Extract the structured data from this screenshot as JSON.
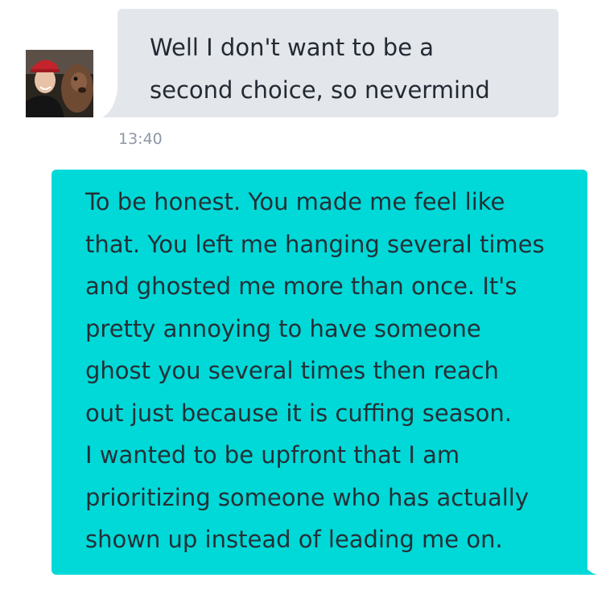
{
  "incoming_message": {
    "lines": [
      "Well I don't want to be a",
      "second choice, so nevermind"
    ]
  },
  "timestamp": "13:40",
  "outgoing_message": {
    "lines": [
      "To be honest. You made me feel like",
      "that. You left me hanging several times",
      "and ghosted me more than once. It's",
      "pretty annoying to have someone",
      "ghost you several times then reach",
      "out just because it is cuffing season.",
      "I wanted to be upfront that I am",
      "prioritizing someone who has actually",
      "shown up instead of leading me on."
    ]
  },
  "colors": {
    "incoming_bubble": "#e3e6ea",
    "outgoing_bubble": "#00d9d8",
    "timestamp_text": "#8d97a4",
    "message_text": "#232a33"
  }
}
